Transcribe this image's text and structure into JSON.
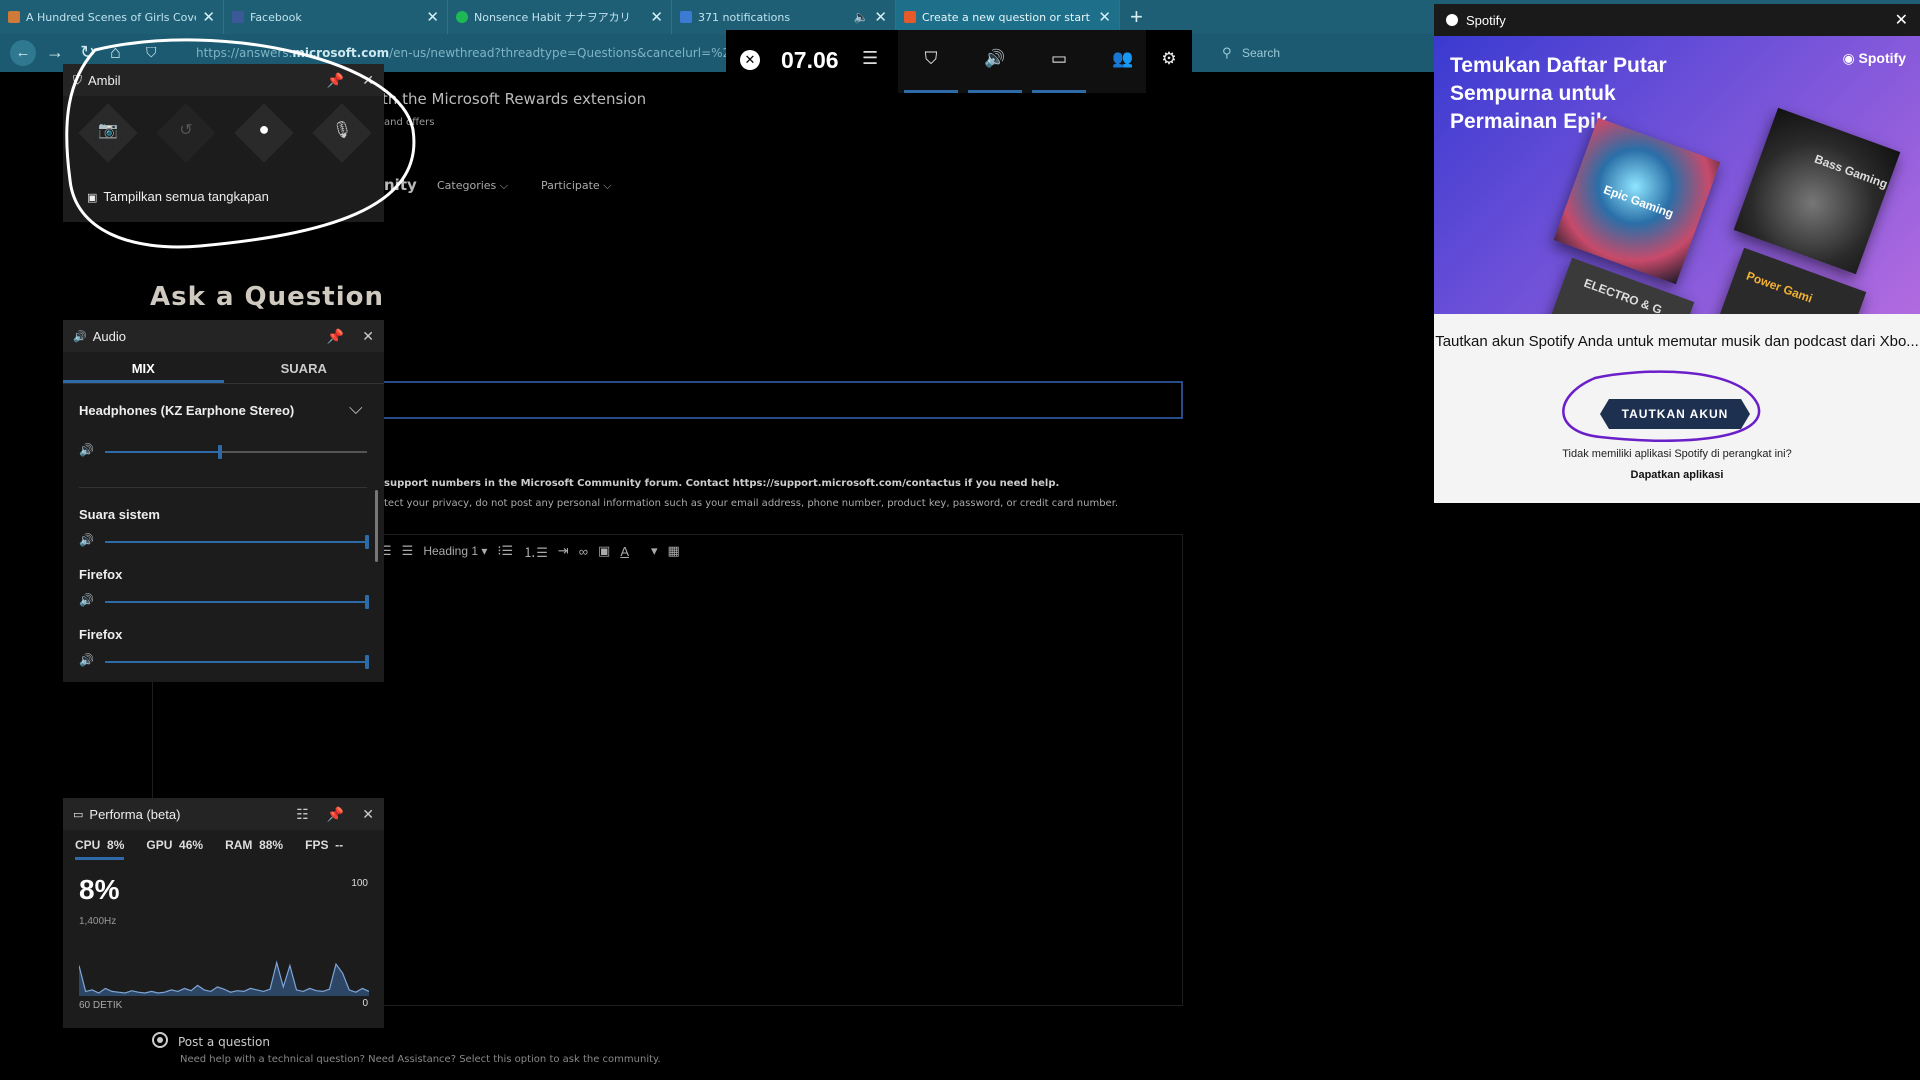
{
  "browser": {
    "tabs": [
      {
        "title": "A Hundred Scenes of Girls Cove ·",
        "favicon_color": "#d07a3a"
      },
      {
        "title": "Facebook",
        "favicon_color": "#3b5998"
      },
      {
        "title": "Nonsence Habit ナナヲアカリ",
        "favicon_color": "#1db954"
      },
      {
        "title": "371 notifications",
        "favicon_color": "#3b7bd4"
      },
      {
        "title": "Create a new question or start a",
        "favicon_color": "#e45a2a"
      }
    ],
    "url_prefix": "https://answers.",
    "url_domain": "microsoft.com",
    "url_rest": "/en-us/newthread?threadtype=Questions&cancelurl=%2Fen-us%2",
    "search_placeholder": "Search"
  },
  "page": {
    "rewards_text": "th the Microsoft Rewards extension",
    "offers_text": "and offers",
    "nav_community": "nity",
    "nav_categories": "Categories",
    "nav_participate": "Participate",
    "ask_title": "Ask a Question",
    "notice_1": "support numbers in the Microsoft Community forum. Contact https://support.microsoft.com/contactus if you need help.",
    "notice_2": "tect your privacy, do not post any personal information such as your email address, phone number, product key, password, or credit card number.",
    "heading_select": "Heading 1",
    "post_question_label": "Post a question",
    "post_question_desc": "Need help with a technical question? Need Assistance? Select this option to ask the community."
  },
  "gamebar": {
    "clock": "07.06"
  },
  "capture_widget": {
    "title": "Ambil",
    "show_all": "Tampilkan semua tangkapan"
  },
  "audio_widget": {
    "title": "Audio",
    "tab_mix": "MIX",
    "tab_voice": "SUARA",
    "device": "Headphones (KZ Earphone Stereo)",
    "master_level": 0.44,
    "apps": [
      {
        "name": "Suara sistem",
        "level": 1.0
      },
      {
        "name": "Firefox",
        "level": 1.0
      },
      {
        "name": "Firefox",
        "level": 1.0
      }
    ]
  },
  "perf_widget": {
    "title": "Performa (beta)",
    "cpu_label": "CPU",
    "cpu_val": "8%",
    "gpu_label": "GPU",
    "gpu_val": "46%",
    "ram_label": "RAM",
    "ram_val": "88%",
    "fps_label": "FPS",
    "fps_val": "--",
    "big_value": "8%",
    "freq": "1,400Hz",
    "y_max": "100",
    "y_min": "0",
    "x_label": "60 DETIK",
    "cpu_history": [
      40,
      6,
      8,
      4,
      10,
      6,
      5,
      4,
      7,
      5,
      4,
      6,
      4,
      5,
      8,
      6,
      10,
      7,
      14,
      8,
      6,
      12,
      9,
      5,
      7,
      6,
      10,
      8,
      6,
      9,
      44,
      12,
      40,
      8,
      6,
      10,
      7,
      6,
      9,
      42,
      30,
      8,
      5,
      10,
      6
    ]
  },
  "spotify": {
    "title": "Spotify",
    "banner_title": "Temukan Daftar Putar Sempurna untuk Permainan Epik",
    "logo": "Spotify",
    "cover_1": "Epic Gaming",
    "cover_2": "Bass Gaming",
    "cover_3": "ELECTRO & G",
    "cover_4": "Power Gami",
    "body": "Tautkan akun Spotify Anda untuk memutar musik dan podcast dari Xbo...",
    "button": "TAUTKAN AKUN",
    "no_app": "Tidak memiliki aplikasi Spotify di perangkat ini?",
    "get_app": "Dapatkan aplikasi"
  }
}
